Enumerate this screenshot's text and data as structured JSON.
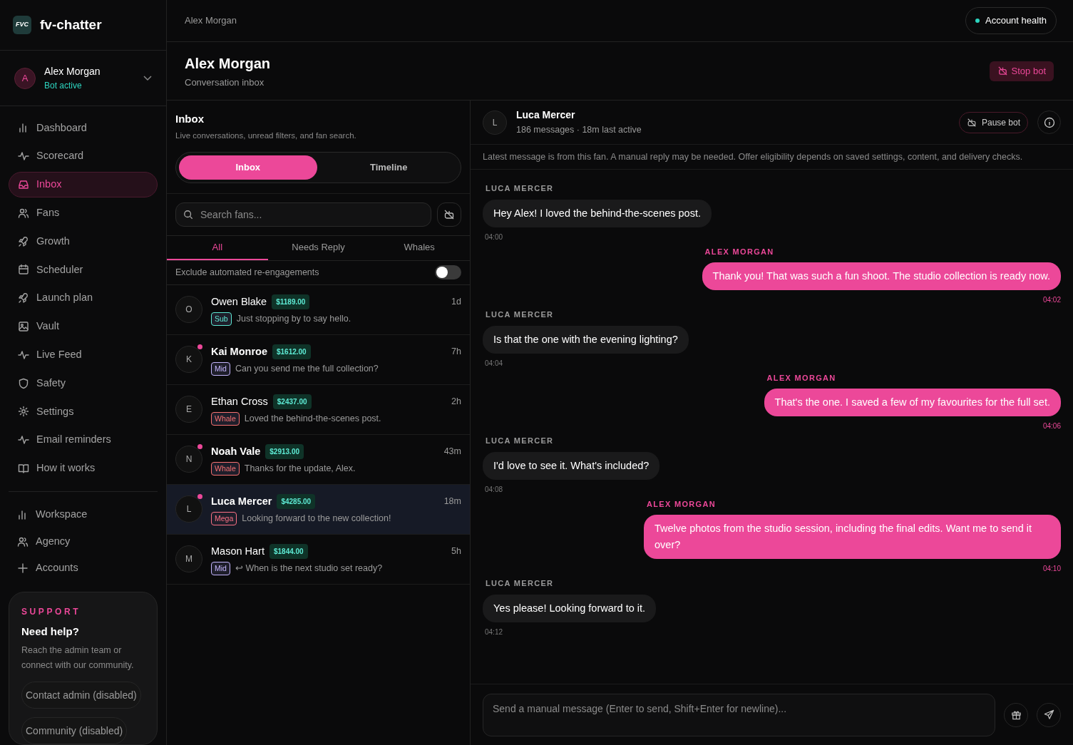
{
  "brand": {
    "name": "fv-chatter",
    "logo": "FVC"
  },
  "account": {
    "initial": "A",
    "name": "Alex Morgan",
    "status": "Bot active"
  },
  "nav": [
    {
      "label": "Dashboard",
      "selected": false
    },
    {
      "label": "Scorecard",
      "selected": false
    },
    {
      "label": "Inbox",
      "selected": true
    },
    {
      "label": "Fans",
      "selected": false
    },
    {
      "label": "Growth",
      "selected": false
    },
    {
      "label": "Scheduler",
      "selected": false
    },
    {
      "label": "Launch plan",
      "selected": false
    },
    {
      "label": "Vault",
      "selected": false
    },
    {
      "label": "Live Feed",
      "selected": false
    },
    {
      "label": "Safety",
      "selected": false
    },
    {
      "label": "Settings",
      "selected": false
    },
    {
      "label": "Email reminders",
      "selected": false
    },
    {
      "label": "How it works",
      "selected": false
    }
  ],
  "nav_secondary": [
    {
      "label": "Workspace"
    },
    {
      "label": "Agency"
    },
    {
      "label": "Accounts"
    }
  ],
  "support": {
    "eyebrow": "SUPPORT",
    "title": "Need help?",
    "text": "Reach the admin team or connect with our community.",
    "buttons": [
      "Contact admin (disabled)",
      "Community (disabled)"
    ]
  },
  "breadcrumb": "Alex Morgan",
  "account_health": "Account health",
  "header": {
    "title": "Alex Morgan",
    "subtitle": "Conversation inbox",
    "stop_button": "Stop bot"
  },
  "inbox": {
    "title": "Inbox",
    "subtitle": "Live conversations, unread filters, and fan search.",
    "modes": [
      {
        "label": "Inbox",
        "selected": true
      },
      {
        "label": "Timeline",
        "selected": false
      }
    ],
    "search": {
      "placeholder": "Search fans..."
    },
    "filters": [
      {
        "label": "All",
        "selected": true
      },
      {
        "label": "Needs Reply",
        "selected": false
      },
      {
        "label": "Whales",
        "selected": false
      }
    ],
    "exclude_toggle": {
      "label": "Exclude automated re-engagements",
      "on": false
    },
    "fans": [
      {
        "initial": "O",
        "name": "Owen Blake",
        "spend": "$1189.00",
        "time": "1d",
        "tier": "Sub",
        "color": "#5eead4",
        "preview": "Just stopping by to say hello.",
        "unread": false,
        "selected": false
      },
      {
        "initial": "K",
        "name": "Kai Monroe",
        "spend": "$1612.00",
        "time": "7h",
        "tier": "Mid",
        "color": "#c4b5fd",
        "preview": "Can you send me the full collection?",
        "unread": true,
        "selected": false
      },
      {
        "initial": "E",
        "name": "Ethan Cross",
        "spend": "$2437.00",
        "time": "2h",
        "tier": "Whale",
        "color": "#f87171",
        "preview": "Loved the behind-the-scenes post.",
        "unread": false,
        "selected": false
      },
      {
        "initial": "N",
        "name": "Noah Vale",
        "spend": "$2913.00",
        "time": "43m",
        "tier": "Whale",
        "color": "#f87171",
        "preview": "Thanks for the update, Alex.",
        "unread": true,
        "selected": false
      },
      {
        "initial": "L",
        "name": "Luca Mercer",
        "spend": "$4285.00",
        "time": "18m",
        "tier": "Mega",
        "color": "#fb7185",
        "preview": "Looking forward to the new collection!",
        "unread": true,
        "selected": true
      },
      {
        "initial": "M",
        "name": "Mason Hart",
        "spend": "$1844.00",
        "time": "5h",
        "tier": "Mid",
        "color": "#c4b5fd",
        "preview": "↩ When is the next studio set ready?",
        "unread": false,
        "selected": false
      }
    ]
  },
  "chat": {
    "initial": "L",
    "name": "Luca Mercer",
    "meta": "186 messages · 18m last active",
    "pause_button": "Pause bot",
    "notice": "Latest message is from this fan. A manual reply may be needed. Offer eligibility depends on saved settings, content, and delivery checks.",
    "messages": [
      {
        "kind": "fan",
        "sender": "LUCA MERCER",
        "text": "Hey Alex! I loved the behind-the-scenes post.",
        "time": "04:00"
      },
      {
        "kind": "creator",
        "sender": "ALEX MORGAN",
        "text": "Thank you! That was such a fun shoot. The studio collection is ready now.",
        "time": "04:02"
      },
      {
        "kind": "fan",
        "sender": "LUCA MERCER",
        "text": "Is that the one with the evening lighting?",
        "time": "04:04"
      },
      {
        "kind": "creator",
        "sender": "ALEX MORGAN",
        "text": "That's the one. I saved a few of my favourites for the full set.",
        "time": "04:06"
      },
      {
        "kind": "fan",
        "sender": "LUCA MERCER",
        "text": "I'd love to see it. What's included?",
        "time": "04:08"
      },
      {
        "kind": "creator",
        "sender": "ALEX MORGAN",
        "text": "Twelve photos from the studio session, including the final edits. Want me to send it over?",
        "time": "04:10"
      },
      {
        "kind": "fan",
        "sender": "LUCA MERCER",
        "text": "Yes please! Looking forward to it.",
        "time": "04:12"
      }
    ],
    "composer": {
      "placeholder": "Send a manual message (Enter to send, Shift+Enter for newline)..."
    }
  }
}
